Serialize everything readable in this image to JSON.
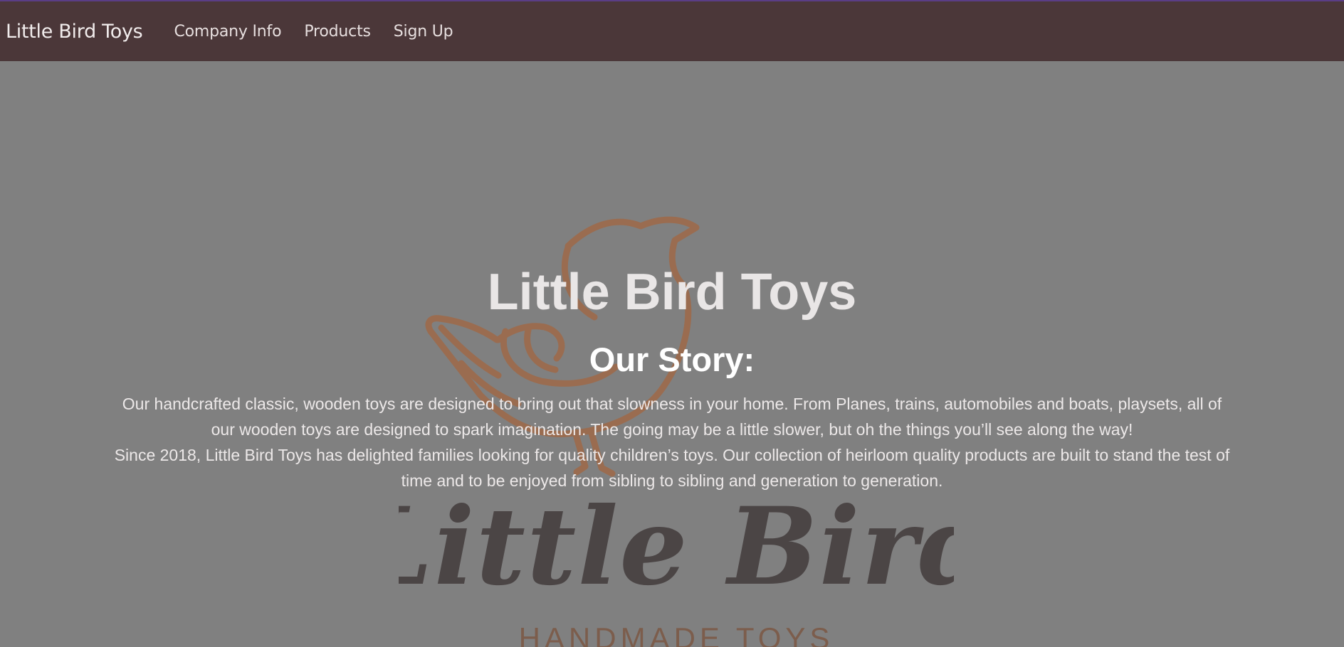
{
  "navbar": {
    "brand": "Little Bird Toys",
    "links": [
      {
        "label": "Company Info"
      },
      {
        "label": "Products"
      },
      {
        "label": "Sign Up"
      }
    ]
  },
  "hero": {
    "logo_script": "Little Bird",
    "logo_tagline": "HANDMADE TOYS",
    "title": "Little Bird Toys",
    "subtitle": "Our Story:",
    "paragraph_1": "Our handcrafted classic, wooden toys are designed to bring out that slowness in your home. From Planes, trains, automobiles and boats, playsets, all of our wooden toys are designed to spark imagination. The going may be a little slower, but oh the things you’ll see along the way!",
    "paragraph_2": "Since 2018, Little Bird Toys has delighted families looking for quality children’s toys. Our collection of heirloom quality products are built to stand the test of time and to be enjoyed from sibling to sibling and generation to generation."
  },
  "colors": {
    "navbar_bg": "#4b3739",
    "hero_overlay": "#808080",
    "bird_outline": "#a86236",
    "logo_script": "#2e2526"
  }
}
